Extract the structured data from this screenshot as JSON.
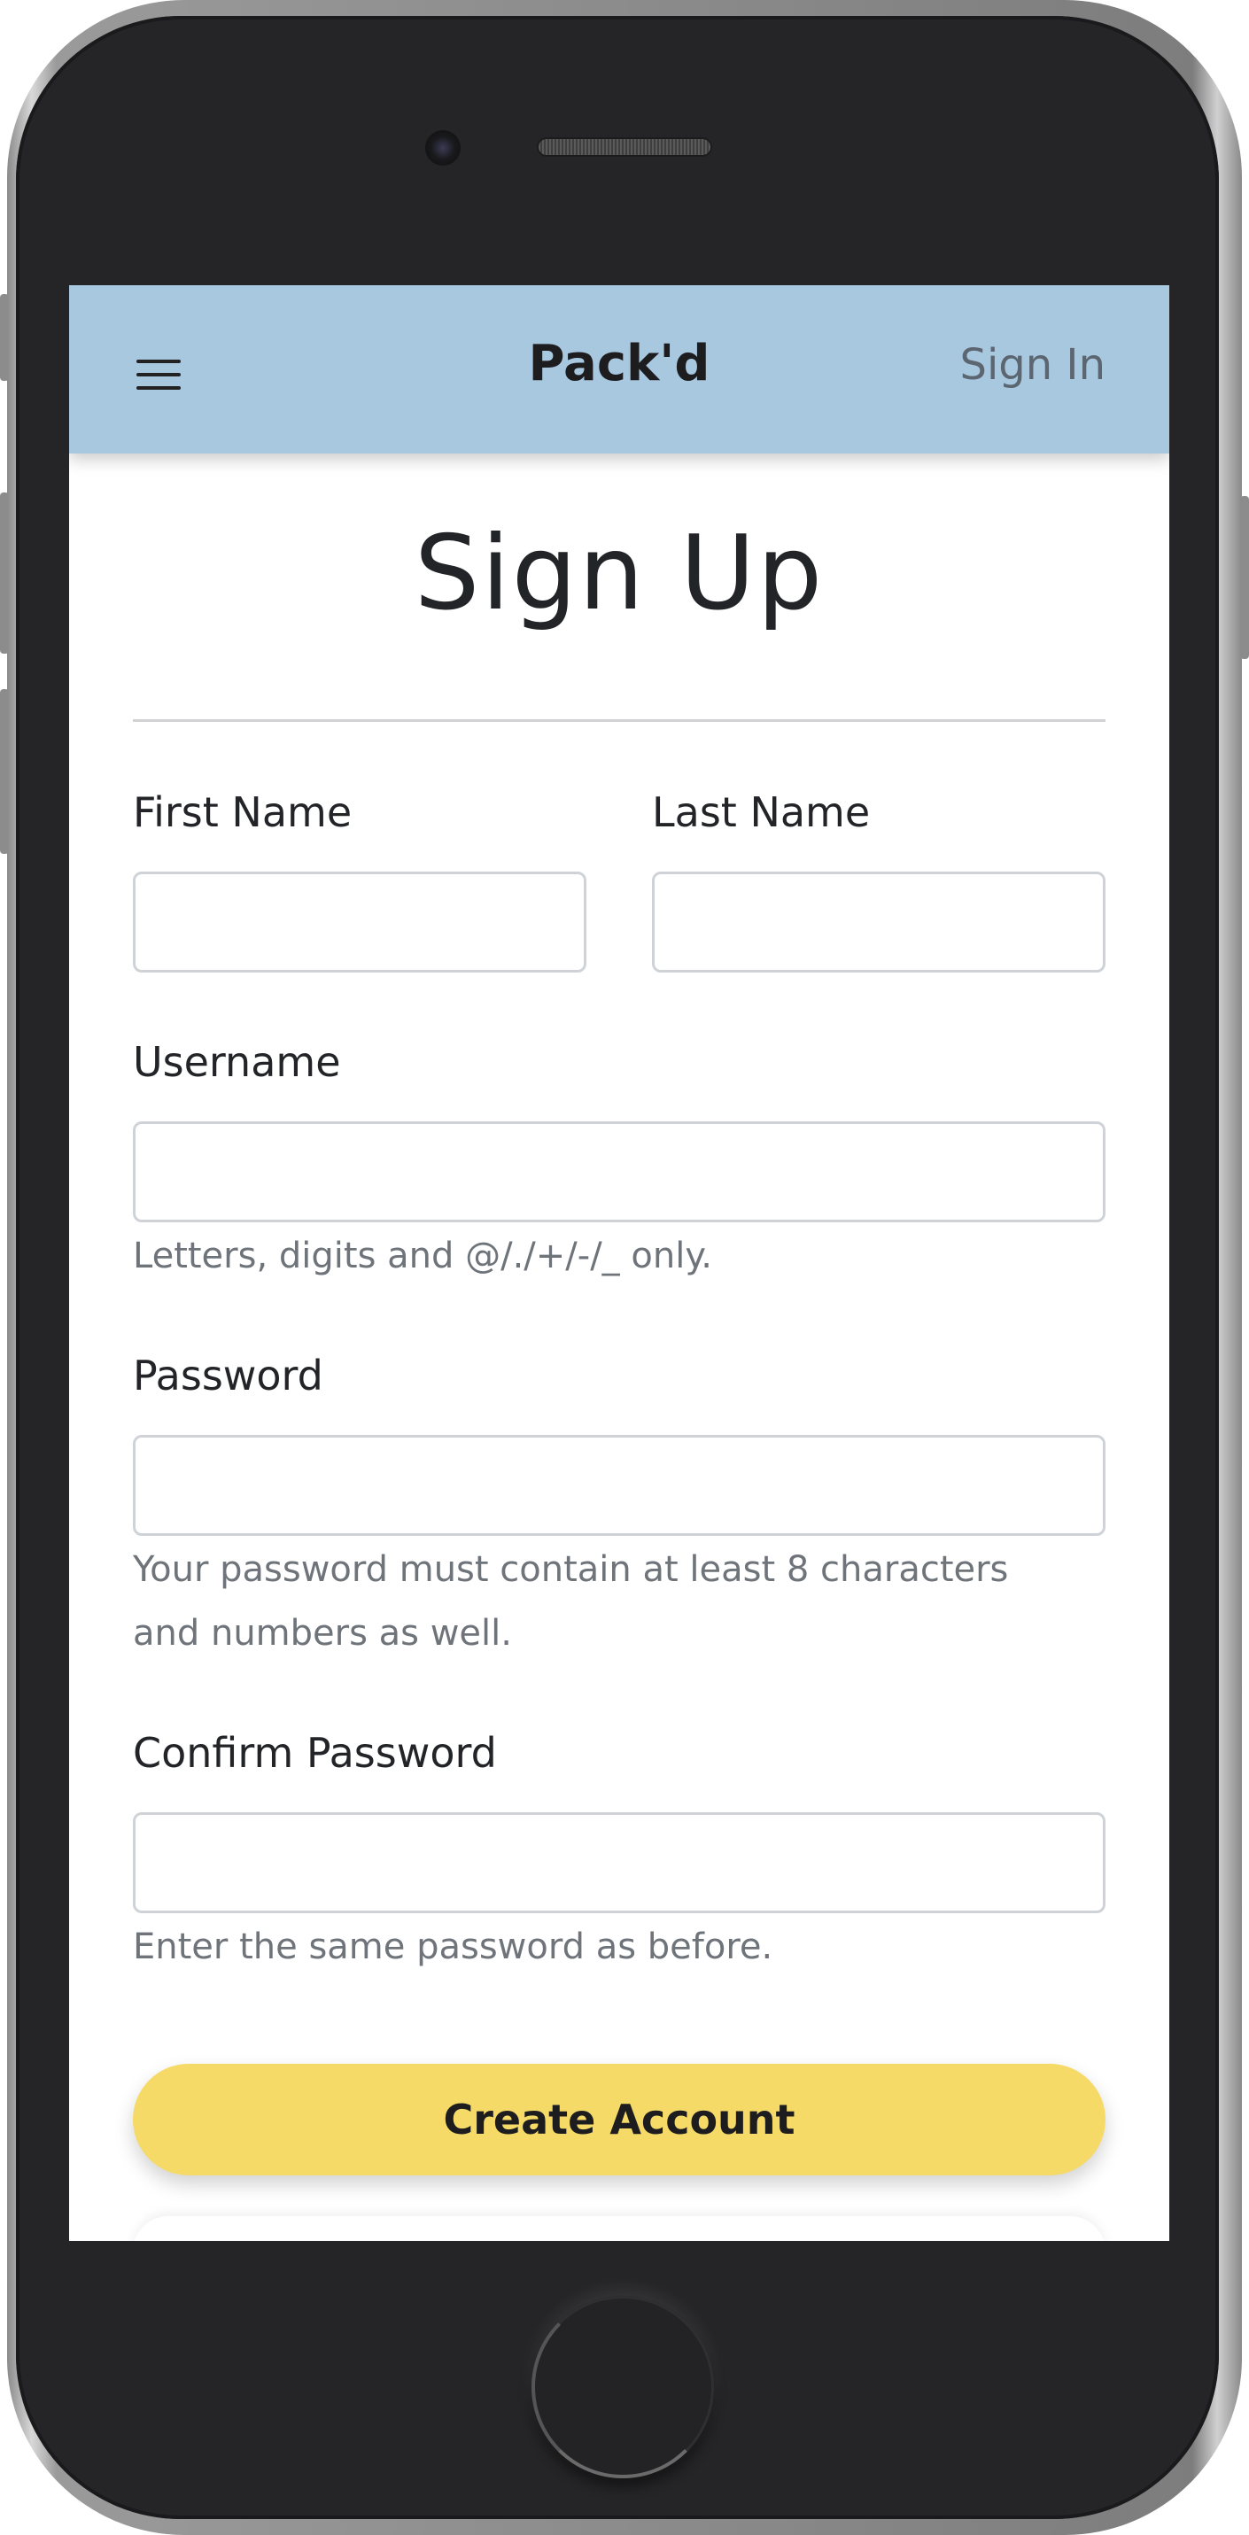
{
  "navbar": {
    "brand": "Pack'd",
    "sign_in": "Sign In"
  },
  "page": {
    "title": "Sign Up"
  },
  "form": {
    "first_name": {
      "label": "First Name",
      "value": ""
    },
    "last_name": {
      "label": "Last Name",
      "value": ""
    },
    "username": {
      "label": "Username",
      "value": "",
      "help": "Letters, digits and @/./+/-/_ only."
    },
    "password": {
      "label": "Password",
      "value": "",
      "help": "Your password must contain at least 8 characters and numbers as well."
    },
    "confirm_password": {
      "label": "Confirm Password",
      "value": "",
      "help": "Enter the same password as before."
    },
    "submit_label": "Create Account"
  },
  "colors": {
    "navbar": "#a8c8e0",
    "primary_button": "#f6da68",
    "phone_body": "#252527"
  },
  "icons": {
    "menu": "hamburger-menu-icon"
  }
}
